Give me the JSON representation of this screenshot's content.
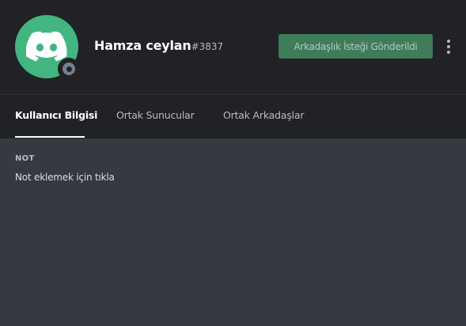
{
  "user": {
    "username": "Hamza ceylan",
    "discriminator": "#3837",
    "avatar": "discord-default-avatar",
    "avatar_color": "#43b581",
    "status": "offline"
  },
  "actions": {
    "friend_request_label": "Arkadaşlık İsteği Gönderildi",
    "friend_request_color": "#3e7c5a",
    "more_icon": "more-vertical-icon"
  },
  "tabs": [
    {
      "label": "Kullanıcı Bilgisi",
      "active": true
    },
    {
      "label": "Ortak Sunucular",
      "active": false
    },
    {
      "label": "Ortak Arkadaşlar",
      "active": false
    }
  ],
  "note": {
    "label": "NOT",
    "placeholder": "Not eklemek için tıkla"
  },
  "colors": {
    "header_bg": "#202225",
    "body_bg": "#36393f"
  }
}
